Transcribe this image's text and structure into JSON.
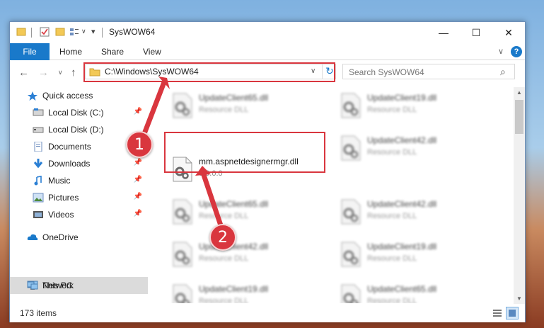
{
  "window": {
    "title": "SysWOW64",
    "minimize_glyph": "—",
    "maximize_glyph": "☐",
    "close_glyph": "✕"
  },
  "ribbon": {
    "tabs": [
      "File",
      "Home",
      "Share",
      "View"
    ],
    "expand_glyph": "∨",
    "help_glyph": "?"
  },
  "nav": {
    "back_glyph": "←",
    "forward_glyph": "→",
    "recent_glyph": "∨",
    "up_glyph": "↑",
    "address": "C:\\Windows\\SysWOW64",
    "refresh_glyph": "↻",
    "dropdown_glyph": "∨",
    "search_placeholder": "Search SysWOW64",
    "search_glyph": "⌕"
  },
  "sidebar": {
    "items": [
      {
        "label": "Quick access",
        "icon": "star-icon",
        "pinned": false
      },
      {
        "label": "Local Disk (C:)",
        "icon": "drive-icon",
        "pinned": true
      },
      {
        "label": "Local Disk (D:)",
        "icon": "drive-icon",
        "pinned": false
      },
      {
        "label": "Documents",
        "icon": "documents-icon",
        "pinned": true
      },
      {
        "label": "Downloads",
        "icon": "download-icon",
        "pinned": true
      },
      {
        "label": "Music",
        "icon": "music-icon",
        "pinned": true
      },
      {
        "label": "Pictures",
        "icon": "pictures-icon",
        "pinned": true
      },
      {
        "label": "Videos",
        "icon": "videos-icon",
        "pinned": true
      },
      {
        "label": "OneDrive",
        "icon": "cloud-icon",
        "pinned": false
      },
      {
        "label": "This PC",
        "icon": "pc-icon",
        "pinned": false
      },
      {
        "label": "Network",
        "icon": "network-icon",
        "pinned": false
      }
    ],
    "pin_glyph": "📌"
  },
  "files": {
    "left": [
      {
        "name": "UpdateClient65.dll",
        "type": "Resource DLL",
        "blurred": true
      },
      {
        "name": "mm.aspnetdesignermgr.dll",
        "type": "0.0.0.0",
        "blurred": false
      },
      {
        "name": "UpdateClient65.dll",
        "type": "Resource DLL",
        "blurred": true
      },
      {
        "name": "UpdateClient42.dll",
        "type": "Resource DLL",
        "blurred": true
      },
      {
        "name": "UpdateClient19.dll",
        "type": "Resource DLL",
        "blurred": true
      }
    ],
    "right": [
      {
        "name": "UpdateClient19.dll",
        "type": "Resource DLL",
        "blurred": true
      },
      {
        "name": "UpdateClient42.dll",
        "type": "Resource DLL",
        "blurred": true
      },
      {
        "name": "UpdateClient42.dll",
        "type": "Resource DLL",
        "blurred": true
      },
      {
        "name": "UpdateClient19.dll",
        "type": "Resource DLL",
        "blurred": true
      },
      {
        "name": "UpdateClient65.dll",
        "type": "Resource DLL",
        "blurred": true
      }
    ]
  },
  "status": {
    "item_count": "173 items"
  },
  "annotations": {
    "step1": "1",
    "step2": "2",
    "color": "#d9363e"
  }
}
